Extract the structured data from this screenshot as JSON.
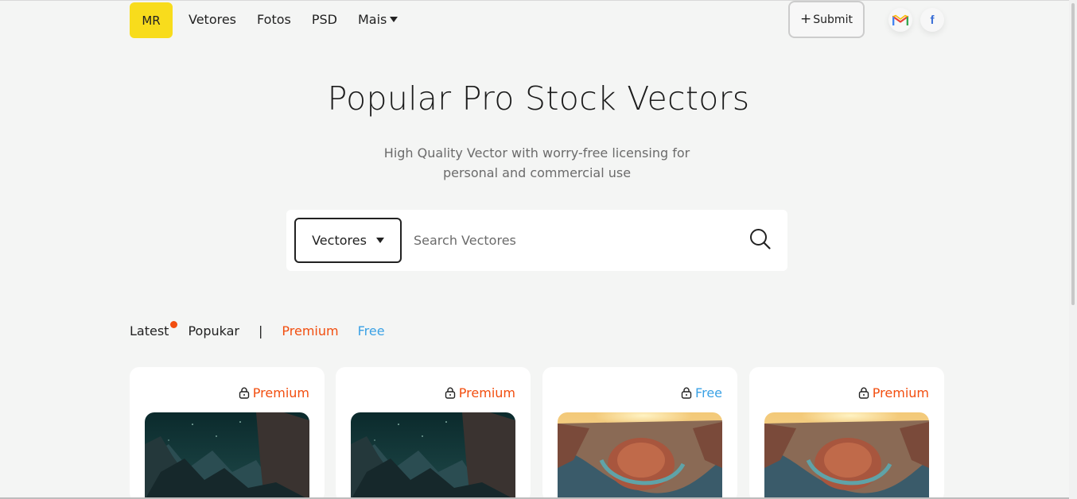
{
  "header": {
    "logo_text": "MR",
    "nav": [
      {
        "label": "Vetores"
      },
      {
        "label": "Fotos"
      },
      {
        "label": "PSD"
      },
      {
        "label": "Mais"
      }
    ],
    "submit_label": "Submit"
  },
  "hero": {
    "title": "Popular Pro Stock Vectors",
    "subtitle": "High Quality Vector with worry-free licensing for personal and commercial use"
  },
  "search": {
    "category": "Vectores",
    "placeholder": "Search Vectores"
  },
  "tabs": {
    "latest": "Latest",
    "popular": "Popukar",
    "separator": "|",
    "premium": "Premium",
    "free": "Free"
  },
  "cards": [
    {
      "badge": "Premium",
      "image": "night-mountains"
    },
    {
      "badge": "Premium",
      "image": "night-mountains"
    },
    {
      "badge": "Free",
      "image": "horseshoe-bend-canyon"
    },
    {
      "badge": "Premium",
      "image": "horseshoe-bend-canyon"
    }
  ],
  "colors": {
    "logo": "#f8dc1c",
    "premium": "#f24e0f",
    "free": "#3aa1e5",
    "background": "#f4f5f4"
  }
}
